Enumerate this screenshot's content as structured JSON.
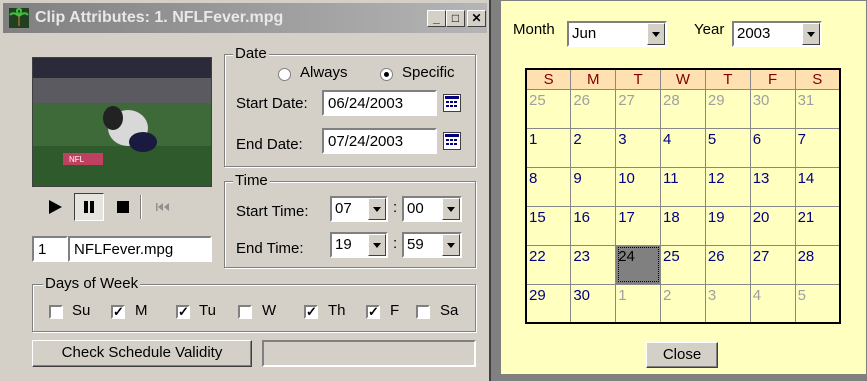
{
  "dialog": {
    "title": "Clip Attributes: 1. NFLFever.mpg",
    "clip_index": "1",
    "clip_name": "NFLFever.mpg",
    "date_group": {
      "legend": "Date",
      "always_label": "Always",
      "specific_label": "Specific",
      "selected": "Specific",
      "start_label": "Start Date:",
      "start_value": "06/24/2003",
      "end_label": "End Date:",
      "end_value": "07/24/2003"
    },
    "time_group": {
      "legend": "Time",
      "start_label": "Start Time:",
      "start_hour": "07",
      "start_minute": "00",
      "end_label": "End Time:",
      "end_hour": "19",
      "end_minute": "59",
      "separator": ":"
    },
    "days_group": {
      "legend": "Days of Week",
      "days": [
        {
          "label": "Su",
          "checked": false
        },
        {
          "label": "M",
          "checked": true
        },
        {
          "label": "Tu",
          "checked": true
        },
        {
          "label": "W",
          "checked": false
        },
        {
          "label": "Th",
          "checked": true
        },
        {
          "label": "F",
          "checked": true
        },
        {
          "label": "Sa",
          "checked": false
        }
      ]
    },
    "check_button": "Check Schedule Validity",
    "status_text": ""
  },
  "calendar": {
    "month_label": "Month",
    "month_value": "Jun",
    "year_label": "Year",
    "year_value": "2003",
    "weekdays": [
      "S",
      "M",
      "T",
      "W",
      "T",
      "F",
      "S"
    ],
    "weeks": [
      [
        "25",
        "26",
        "27",
        "28",
        "29",
        "30",
        "31"
      ],
      [
        "1",
        "2",
        "3",
        "4",
        "5",
        "6",
        "7"
      ],
      [
        "8",
        "9",
        "10",
        "11",
        "12",
        "13",
        "14"
      ],
      [
        "15",
        "16",
        "17",
        "18",
        "19",
        "20",
        "21"
      ],
      [
        "22",
        "23",
        "24",
        "25",
        "26",
        "27",
        "28"
      ],
      [
        "29",
        "30",
        "1",
        "2",
        "3",
        "4",
        "5"
      ]
    ],
    "selected_day": "24",
    "close_label": "Close"
  },
  "colors": {
    "calendar_bg": "#ffffc0",
    "current_month_text": "#000080",
    "other_month_text": "#a0a0a0",
    "weekday_header_text": "#800000"
  }
}
